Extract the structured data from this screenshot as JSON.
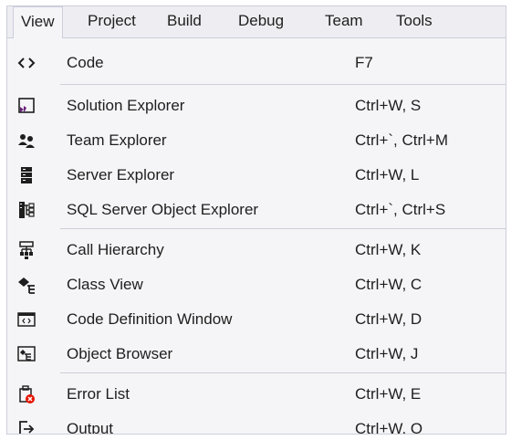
{
  "menubar": {
    "items": [
      {
        "label": "View",
        "active": true
      },
      {
        "label": "Project"
      },
      {
        "label": "Build"
      },
      {
        "label": "Debug"
      },
      {
        "label": "Team"
      },
      {
        "label": "Tools"
      }
    ]
  },
  "menu": {
    "items": [
      {
        "label": "Code",
        "shortcut": "F7",
        "icon": "code-brackets-icon"
      },
      {
        "label": "Solution Explorer",
        "shortcut": "Ctrl+W, S",
        "icon": "solution-explorer-icon"
      },
      {
        "label": "Team Explorer",
        "shortcut": "Ctrl+`, Ctrl+M",
        "icon": "team-explorer-icon"
      },
      {
        "label": "Server Explorer",
        "shortcut": "Ctrl+W, L",
        "icon": "server-explorer-icon"
      },
      {
        "label": "SQL Server Object Explorer",
        "shortcut": "Ctrl+`, Ctrl+S",
        "icon": "sql-server-object-explorer-icon"
      },
      {
        "label": "Call Hierarchy",
        "shortcut": "Ctrl+W, K",
        "icon": "call-hierarchy-icon"
      },
      {
        "label": "Class View",
        "shortcut": "Ctrl+W, C",
        "icon": "class-view-icon"
      },
      {
        "label": "Code Definition Window",
        "shortcut": "Ctrl+W, D",
        "icon": "code-definition-window-icon"
      },
      {
        "label": "Object Browser",
        "shortcut": "Ctrl+W, J",
        "icon": "object-browser-icon"
      },
      {
        "label": "Error List",
        "shortcut": "Ctrl+W, E",
        "icon": "error-list-icon"
      },
      {
        "label": "Output",
        "shortcut": "Ctrl+W, O",
        "icon": "output-icon"
      }
    ]
  },
  "colors": {
    "text": "#1e1e1e",
    "menu_background": "#f5f5f7",
    "separator": "#cccedb",
    "accent_purple": "#68217a",
    "error_red": "#e51400",
    "class_teal": "#00539c"
  }
}
